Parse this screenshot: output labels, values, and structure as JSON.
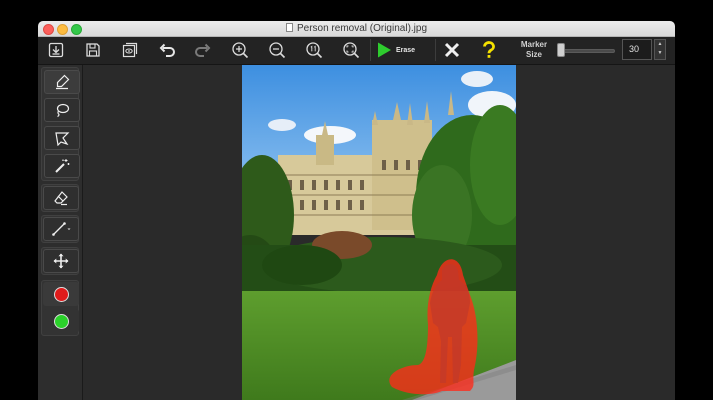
{
  "window": {
    "title": "Person removal (Original).jpg"
  },
  "toolbar": {
    "buttons": [
      {
        "id": "open",
        "icon": "open-file-icon"
      },
      {
        "id": "save",
        "icon": "save-icon"
      },
      {
        "id": "preview",
        "icon": "preview-icon"
      },
      {
        "id": "undo",
        "icon": "undo-icon"
      },
      {
        "id": "redo",
        "icon": "redo-icon"
      },
      {
        "id": "zoom_in",
        "icon": "zoom-in-icon"
      },
      {
        "id": "zoom_out",
        "icon": "zoom-out-icon"
      },
      {
        "id": "zoom_actual",
        "icon": "zoom-actual-size-icon"
      },
      {
        "id": "zoom_fit",
        "icon": "zoom-fit-icon"
      }
    ],
    "erase_label": "Erase",
    "cancel_icon": "x-icon",
    "help_icon": "question-mark-icon",
    "marker_label": "Marker Size",
    "marker_size_value": "30",
    "marker_slider_level": 0.05
  },
  "tools": [
    {
      "name": "marker-tool",
      "icon": "marker-pen-icon",
      "active": true
    },
    {
      "name": "lasso-tool",
      "icon": "lasso-icon",
      "active": false
    },
    {
      "name": "polygon-lasso-tool",
      "icon": "polygon-lasso-icon",
      "active": false
    },
    {
      "name": "magic-wand-tool",
      "icon": "magic-wand-icon",
      "active": false
    },
    {
      "name": "eraser-tool",
      "icon": "eraser-icon",
      "active": false
    },
    {
      "name": "line-tool",
      "icon": "line-icon",
      "active": false
    },
    {
      "name": "move-tool",
      "icon": "move-arrows-icon",
      "active": false
    }
  ],
  "colors": {
    "remove_color": "#e01b1b",
    "keep_color": "#2bd22b",
    "mask_color": "#ff2a1a",
    "erase_play": "#2ecc2e",
    "help_yellow": "#f5e100"
  }
}
